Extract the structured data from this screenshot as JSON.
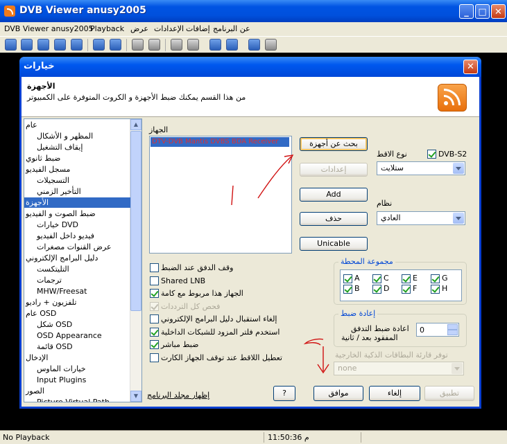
{
  "window": {
    "title": "DVB Viewer anusy2005"
  },
  "menu": [
    "DVB Viewer anusy2005",
    "Playback",
    "عرض",
    "الإعدادات",
    "إضافات",
    "عن البرنامج"
  ],
  "status": {
    "left": "No Playback",
    "time": "11:50:36 م"
  },
  "dialog": {
    "title": "خيارات",
    "header_title": "الأجهزة",
    "header_desc": "من هذا القسم يمكنك ضبط الأجهزة و الكروت المتوفرة على الكمبيوتر",
    "tree": [
      "عام",
      "المظهر و الأشكال",
      "إيقاف التشغيل",
      "ضبط ثانوي",
      "مسجل الفيديو",
      "التسجيلات",
      "التأخير الزمني",
      "الأجهزة",
      "ضبط الصوت و الفيديو",
      "خيارات DVD",
      "فيديو داخل الفيديو",
      "عرض القنوات مصغرات",
      "دليل البرامج الإلكتروني",
      "التليتكست",
      "ترجمات",
      "MHW/Freesat",
      "تلفزيون + راديو",
      "عام OSD",
      "شكل OSD",
      "OSD Appearance",
      "قائمة OSD",
      "الإدخال",
      "خيارات الماوس",
      "Input Plugins",
      "الصور",
      "Picture Virtual Path"
    ],
    "device_label": "الجهاز",
    "device_item": "DTV-DVB Mantis DVBS BDA Receiver",
    "buttons": {
      "search": "بحث عن أجهزة",
      "settings": "إعدادات",
      "add": "Add",
      "delete": "حذف",
      "unicable": "Unicable",
      "help": "?",
      "ok": "موافق",
      "cancel": "إلغاء",
      "apply": "تطبيق"
    },
    "type_label": "نوع الاقط",
    "dvbs2_label": "DVB-S2",
    "type_value": "ستلايت",
    "system_label": "نظام",
    "system_value": "العادي",
    "options": [
      {
        "label": "وقف الدفق عند الضبط",
        "checked": false,
        "disabled": false
      },
      {
        "label": "Shared LNB",
        "checked": false,
        "disabled": false
      },
      {
        "label": "الجهاز هذا مربوط مع كامة",
        "checked": true,
        "disabled": false
      },
      {
        "label": "فحص كل الترددات",
        "checked": true,
        "disabled": true
      },
      {
        "label": "إلغاء استقبال دليل البرامج الإلكتروني",
        "checked": false,
        "disabled": false
      },
      {
        "label": "استخدم فلتر المزود للشبكات الداخلية",
        "checked": true,
        "disabled": false
      },
      {
        "label": "ضبط مباشر",
        "checked": true,
        "disabled": false
      },
      {
        "label": "تعطيل اللاقط عند توقف الجهاز الكارت",
        "checked": false,
        "disabled": false
      }
    ],
    "station_group": {
      "title": "مجموعة المحطة",
      "items": [
        {
          "label": "A",
          "checked": true
        },
        {
          "label": "C",
          "checked": true
        },
        {
          "label": "E",
          "checked": true
        },
        {
          "label": "G",
          "checked": true
        },
        {
          "label": "B",
          "checked": true
        },
        {
          "label": "D",
          "checked": true
        },
        {
          "label": "F",
          "checked": true
        },
        {
          "label": "H",
          "checked": true
        }
      ]
    },
    "retune_group": {
      "title": "إعادة ضبط",
      "desc_line1": "اعادة ضبط التدفق",
      "desc_line2": "المفقود بعد / ثانية",
      "value": "0"
    },
    "smartcard_label": "توفر قارئة البطاقات الذكية الخارجية",
    "smartcard_value": "none",
    "show_folder_link": "إظهار مجلد البرنامج"
  }
}
